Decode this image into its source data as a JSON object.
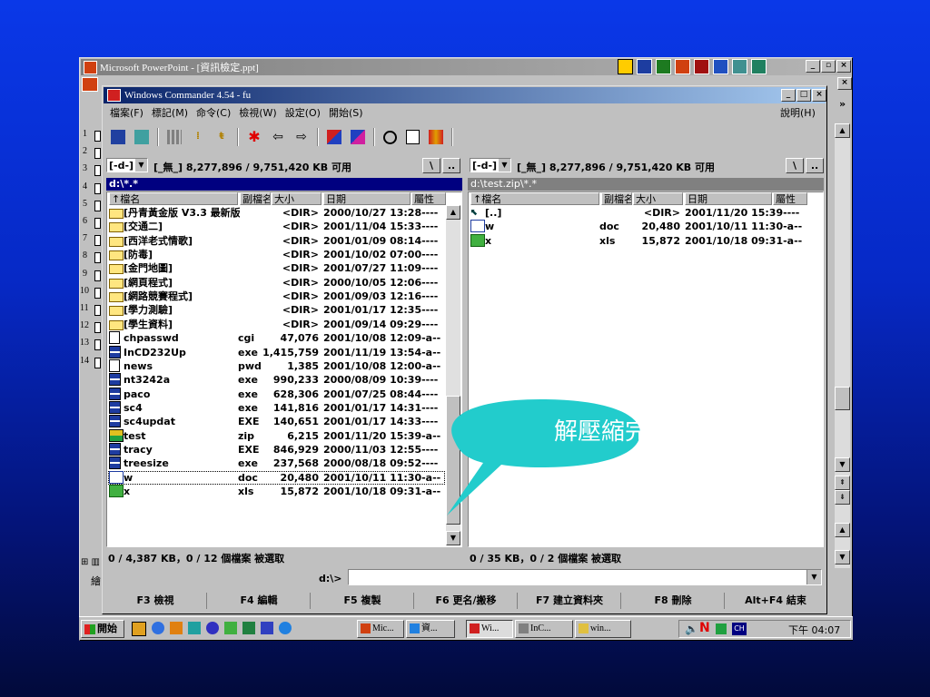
{
  "ppt": {
    "title": "Microsoft PowerPoint - [資訊檢定.ppt]"
  },
  "wc": {
    "title": "Windows Commander 4.54 - fu",
    "menu": [
      "檔案(F)",
      "標記(M)",
      "命令(C)",
      "檢視(W)",
      "設定(O)",
      "開始(S)"
    ],
    "help": "說明(H)"
  },
  "slide_numbers": [
    "1",
    "2",
    "3",
    "4",
    "5",
    "6",
    "7",
    "8",
    "9",
    "10",
    "11",
    "12",
    "13",
    "14"
  ],
  "left": {
    "drive": "[-d-]",
    "drive_info": "[_無_]  8,277,896 / 9,751,420 KB 可用",
    "root_btn": "\\",
    "up_btn": "..",
    "path": "d:\\*.*",
    "headers": [
      "↑檔名",
      "副檔名",
      "大小",
      "日期",
      "屬性"
    ],
    "rows": [
      {
        "name": "[丹青黃金版 V3.3 最新版]",
        "ext": "",
        "size": "<DIR>",
        "date": "2000/10/27 13:28----",
        "type": "folder"
      },
      {
        "name": "[交通二]",
        "ext": "",
        "size": "<DIR>",
        "date": "2001/11/04 15:33----",
        "type": "folder"
      },
      {
        "name": "[西洋老式情歌]",
        "ext": "",
        "size": "<DIR>",
        "date": "2001/01/09 08:14----",
        "type": "folder"
      },
      {
        "name": "[防毒]",
        "ext": "",
        "size": "<DIR>",
        "date": "2001/10/02 07:00----",
        "type": "folder"
      },
      {
        "name": "[金門地圖]",
        "ext": "",
        "size": "<DIR>",
        "date": "2001/07/27 11:09----",
        "type": "folder"
      },
      {
        "name": "[網頁程式]",
        "ext": "",
        "size": "<DIR>",
        "date": "2000/10/05 12:06----",
        "type": "folder"
      },
      {
        "name": "[網路競賽程式]",
        "ext": "",
        "size": "<DIR>",
        "date": "2001/09/03 12:16----",
        "type": "folder"
      },
      {
        "name": "[學力測驗]",
        "ext": "",
        "size": "<DIR>",
        "date": "2001/01/17 12:35----",
        "type": "folder"
      },
      {
        "name": "[學生資料]",
        "ext": "",
        "size": "<DIR>",
        "date": "2001/09/14 09:29----",
        "type": "folder"
      },
      {
        "name": "chpasswd",
        "ext": "cgi",
        "size": "47,076",
        "date": "2001/10/08 12:09-a--",
        "type": "doc"
      },
      {
        "name": "InCD232Up",
        "ext": "exe",
        "size": "1,415,759",
        "date": "2001/11/19 13:54-a--",
        "type": "app"
      },
      {
        "name": "news",
        "ext": "pwd",
        "size": "1,385",
        "date": "2001/10/08 12:00-a--",
        "type": "doc"
      },
      {
        "name": "nt3242a",
        "ext": "exe",
        "size": "990,233",
        "date": "2000/08/09 10:39----",
        "type": "app"
      },
      {
        "name": "paco",
        "ext": "exe",
        "size": "628,306",
        "date": "2001/07/25 08:44----",
        "type": "app"
      },
      {
        "name": "sc4",
        "ext": "exe",
        "size": "141,816",
        "date": "2001/01/17 14:31----",
        "type": "app"
      },
      {
        "name": "sc4updat",
        "ext": "EXE",
        "size": "140,651",
        "date": "2001/01/17 14:33----",
        "type": "app"
      },
      {
        "name": "test",
        "ext": "zip",
        "size": "6,215",
        "date": "2001/11/20 15:39-a--",
        "type": "zip"
      },
      {
        "name": "tracy",
        "ext": "EXE",
        "size": "846,929",
        "date": "2000/11/03 12:55----",
        "type": "app"
      },
      {
        "name": "treesize",
        "ext": "exe",
        "size": "237,568",
        "date": "2000/08/18 09:52----",
        "type": "app"
      },
      {
        "name": "w",
        "ext": "doc",
        "size": "20,480",
        "date": "2001/10/11 11:30-a--",
        "type": "word"
      },
      {
        "name": "x",
        "ext": "xls",
        "size": "15,872",
        "date": "2001/10/18 09:31-a--",
        "type": "excel"
      }
    ],
    "status": "0 / 4,387 KB，0 / 12 個檔案 被選取"
  },
  "right": {
    "drive": "[-d-]",
    "drive_info": "[_無_]  8,277,896 / 9,751,420 KB 可用",
    "root_btn": "\\",
    "up_btn": "..",
    "path": "d:\\test.zip\\*.*",
    "headers": [
      "↑檔名",
      "副檔名",
      "大小",
      "日期",
      "屬性"
    ],
    "rows": [
      {
        "name": "[..]",
        "ext": "",
        "size": "<DIR>",
        "date": "2001/11/20 15:39----",
        "type": "up"
      },
      {
        "name": "w",
        "ext": "doc",
        "size": "20,480",
        "date": "2001/10/11 11:30-a--",
        "type": "word"
      },
      {
        "name": "x",
        "ext": "xls",
        "size": "15,872",
        "date": "2001/10/18 09:31-a--",
        "type": "excel"
      }
    ],
    "status": "0 / 35 KB，0 / 2 個檔案 被選取"
  },
  "cmdline": {
    "prompt": "d:\\>",
    "value": ""
  },
  "fkeys": [
    "F3 檢視",
    "F4 編輯",
    "F5 複製",
    "F6 更名/搬移",
    "F7 建立資料夾",
    "F8 刪除",
    "Alt+F4 結束"
  ],
  "callout": {
    "text": "解壓縮完成",
    "color": "#22cccc"
  },
  "taskbar": {
    "start": "開始",
    "tasks": [
      "Mic...",
      "資...",
      "Wi...",
      "InC...",
      "win..."
    ],
    "clock": "下午 04:07"
  },
  "sidebar_label": "繪",
  "colors": {
    "title_active": "#0a246a",
    "path_active": "#000080",
    "face": "#c0c0c0"
  }
}
